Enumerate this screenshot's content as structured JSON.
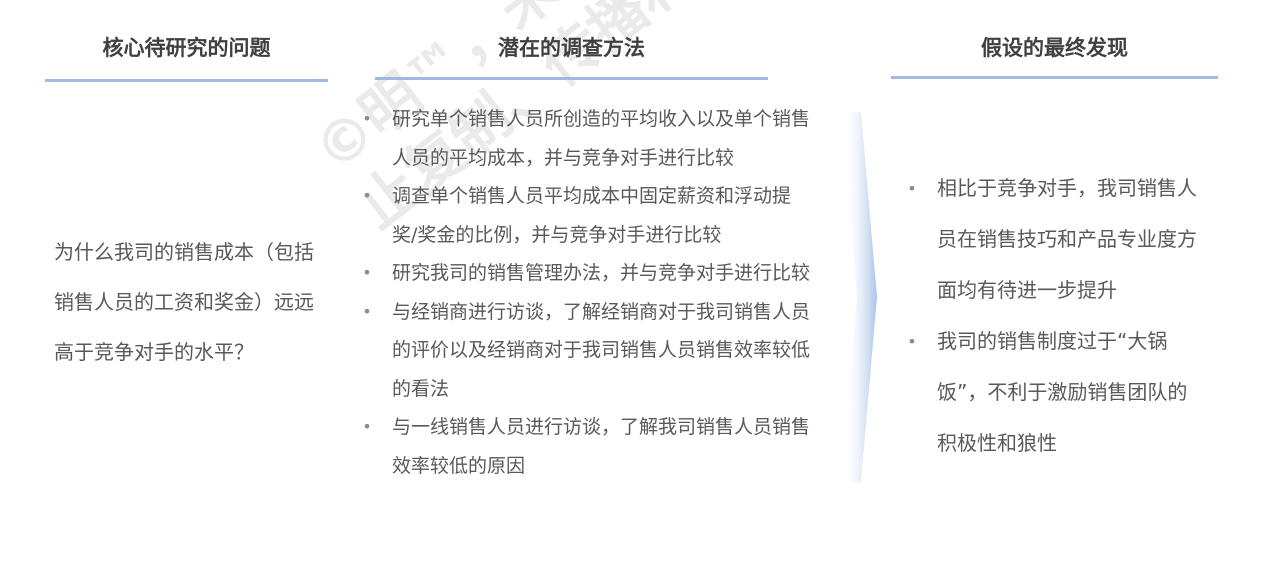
{
  "columns": {
    "question": {
      "title": "核心待研究的问题",
      "text": "为什么我司的销售成本（包括销售人员的工资和奖金）远远高于竞争对手的水平？"
    },
    "methods": {
      "title": "潜在的调查方法",
      "items": [
        "研究单个销售人员所创造的平均收入以及单个销售人员的平均成本，并与竞争对手进行比较",
        "调查单个销售人员平均成本中固定薪资和浮动提奖/奖金的比例，并与竞争对手进行比较",
        "研究我司的销售管理办法，并与竞争对手进行比较",
        "与经销商进行访谈，了解经销商对于我司销售人员的评价以及经销商对于我司销售人员销售效率较低的看法",
        "与一线销售人员进行访谈，了解我司销售人员销售效率较低的原因"
      ]
    },
    "findings": {
      "title": "假设的最终发现",
      "items": [
        "相比于竞争对手，我司销售人员在销售技巧和产品专业度方面均有待进一步提升",
        "我司的销售制度过于“大锅饭”，不利于激励销售团队的积极性和狼性"
      ]
    }
  },
  "watermark": {
    "line1": "©明™，未经允许禁",
    "line2": "止复制、传播和修改"
  },
  "bullet_glyph": "•",
  "colors": {
    "rule": "#9fb9e2",
    "text": "#595959",
    "header": "#404040"
  }
}
